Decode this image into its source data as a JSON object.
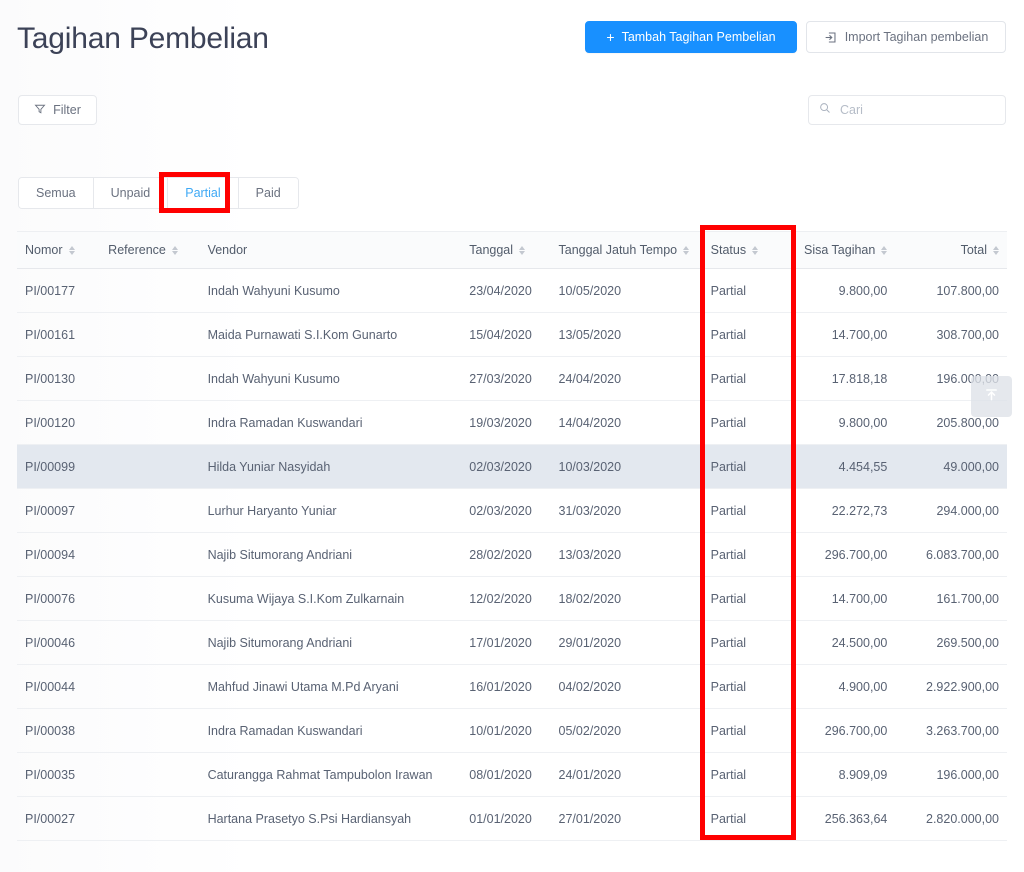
{
  "header": {
    "title": "Tagihan Pembelian",
    "add_button": "Tambah Tagihan Pembelian",
    "add_button_icon_glyph": "+",
    "import_button": "Import Tagihan pembelian",
    "primary_color": "#1890ff"
  },
  "toolbar": {
    "filter_label": "Filter",
    "search_placeholder": "Cari",
    "search_value": ""
  },
  "tabs": {
    "items": [
      {
        "label": "Semua",
        "active": false
      },
      {
        "label": "Unpaid",
        "active": false
      },
      {
        "label": "Partial",
        "active": true
      },
      {
        "label": "Paid",
        "active": false
      }
    ]
  },
  "table": {
    "columns": [
      {
        "label": "Nomor",
        "sortable": true,
        "align": "left"
      },
      {
        "label": "Reference",
        "sortable": true,
        "align": "left"
      },
      {
        "label": "Vendor",
        "sortable": false,
        "align": "left"
      },
      {
        "label": "Tanggal",
        "sortable": true,
        "align": "left"
      },
      {
        "label": "Tanggal Jatuh Tempo",
        "sortable": true,
        "align": "left"
      },
      {
        "label": "Status",
        "sortable": true,
        "align": "left"
      },
      {
        "label": "Sisa Tagihan",
        "sortable": true,
        "align": "right"
      },
      {
        "label": "Total",
        "sortable": true,
        "align": "right"
      }
    ],
    "rows": [
      {
        "nomor": "PI/00177",
        "reference": "",
        "vendor": "Indah Wahyuni Kusumo",
        "tanggal": "23/04/2020",
        "jatuh_tempo": "10/05/2020",
        "status": "Partial",
        "sisa_tagihan": "9.800,00",
        "total": "107.800,00",
        "hovered": false
      },
      {
        "nomor": "PI/00161",
        "reference": "",
        "vendor": "Maida Purnawati S.I.Kom Gunarto",
        "tanggal": "15/04/2020",
        "jatuh_tempo": "13/05/2020",
        "status": "Partial",
        "sisa_tagihan": "14.700,00",
        "total": "308.700,00",
        "hovered": false
      },
      {
        "nomor": "PI/00130",
        "reference": "",
        "vendor": "Indah Wahyuni Kusumo",
        "tanggal": "27/03/2020",
        "jatuh_tempo": "24/04/2020",
        "status": "Partial",
        "sisa_tagihan": "17.818,18",
        "total": "196.000,00",
        "hovered": false
      },
      {
        "nomor": "PI/00120",
        "reference": "",
        "vendor": "Indra Ramadan Kuswandari",
        "tanggal": "19/03/2020",
        "jatuh_tempo": "14/04/2020",
        "status": "Partial",
        "sisa_tagihan": "9.800,00",
        "total": "205.800,00",
        "hovered": false
      },
      {
        "nomor": "PI/00099",
        "reference": "",
        "vendor": "Hilda Yuniar Nasyidah",
        "tanggal": "02/03/2020",
        "jatuh_tempo": "10/03/2020",
        "status": "Partial",
        "sisa_tagihan": "4.454,55",
        "total": "49.000,00",
        "hovered": true
      },
      {
        "nomor": "PI/00097",
        "reference": "",
        "vendor": "Lurhur Haryanto Yuniar",
        "tanggal": "02/03/2020",
        "jatuh_tempo": "31/03/2020",
        "status": "Partial",
        "sisa_tagihan": "22.272,73",
        "total": "294.000,00",
        "hovered": false
      },
      {
        "nomor": "PI/00094",
        "reference": "",
        "vendor": "Najib Situmorang Andriani",
        "tanggal": "28/02/2020",
        "jatuh_tempo": "13/03/2020",
        "status": "Partial",
        "sisa_tagihan": "296.700,00",
        "total": "6.083.700,00",
        "hovered": false
      },
      {
        "nomor": "PI/00076",
        "reference": "",
        "vendor": "Kusuma Wijaya S.I.Kom Zulkarnain",
        "tanggal": "12/02/2020",
        "jatuh_tempo": "18/02/2020",
        "status": "Partial",
        "sisa_tagihan": "14.700,00",
        "total": "161.700,00",
        "hovered": false
      },
      {
        "nomor": "PI/00046",
        "reference": "",
        "vendor": "Najib Situmorang Andriani",
        "tanggal": "17/01/2020",
        "jatuh_tempo": "29/01/2020",
        "status": "Partial",
        "sisa_tagihan": "24.500,00",
        "total": "269.500,00",
        "hovered": false
      },
      {
        "nomor": "PI/00044",
        "reference": "",
        "vendor": "Mahfud Jinawi Utama M.Pd Aryani",
        "tanggal": "16/01/2020",
        "jatuh_tempo": "04/02/2020",
        "status": "Partial",
        "sisa_tagihan": "4.900,00",
        "total": "2.922.900,00",
        "hovered": false
      },
      {
        "nomor": "PI/00038",
        "reference": "",
        "vendor": "Indra Ramadan Kuswandari",
        "tanggal": "10/01/2020",
        "jatuh_tempo": "05/02/2020",
        "status": "Partial",
        "sisa_tagihan": "296.700,00",
        "total": "3.263.700,00",
        "hovered": false
      },
      {
        "nomor": "PI/00035",
        "reference": "",
        "vendor": "Caturangga Rahmat Tampubolon Irawan",
        "tanggal": "08/01/2020",
        "jatuh_tempo": "24/01/2020",
        "status": "Partial",
        "sisa_tagihan": "8.909,09",
        "total": "196.000,00",
        "hovered": false
      },
      {
        "nomor": "PI/00027",
        "reference": "",
        "vendor": "Hartana Prasetyo S.Psi Hardiansyah",
        "tanggal": "01/01/2020",
        "jatuh_tempo": "27/01/2020",
        "status": "Partial",
        "sisa_tagihan": "256.363,64",
        "total": "2.820.000,00",
        "hovered": false
      }
    ],
    "status_color": "#f0a868",
    "link_color": "#3b82e0"
  },
  "annotations": [
    {
      "name": "partial-tab-highlight",
      "color": "#ff0000"
    },
    {
      "name": "status-column-highlight",
      "color": "#ff0000"
    }
  ],
  "scroll_top": {
    "icon": "scroll-to-top-icon"
  }
}
